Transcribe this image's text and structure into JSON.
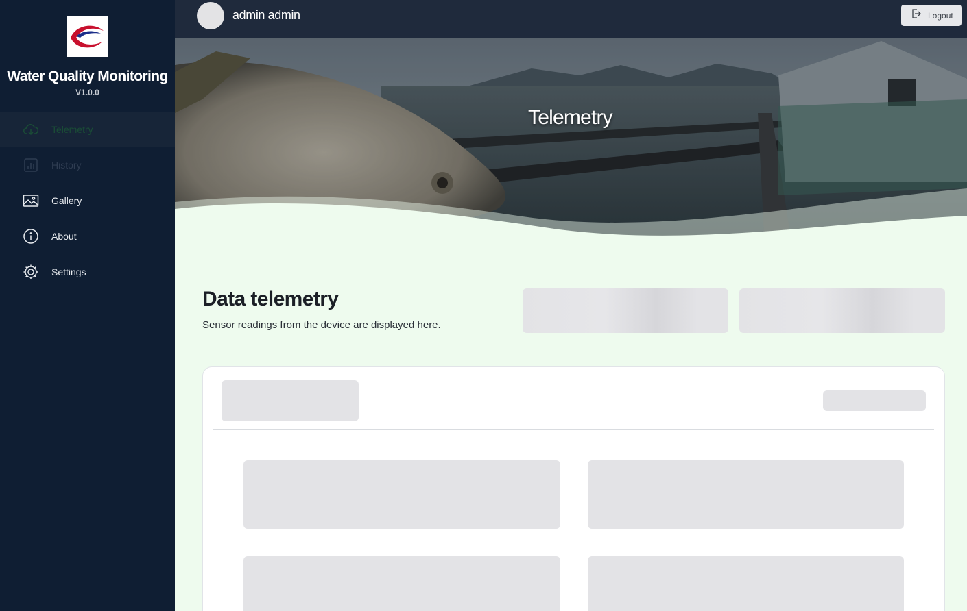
{
  "sidebar": {
    "app_title": "Water Quality Monitoring",
    "version": "V1.0.0",
    "items": [
      {
        "label": "Telemetry",
        "icon": "cloud-download-icon"
      },
      {
        "label": "History",
        "icon": "bar-chart-icon"
      },
      {
        "label": "Gallery",
        "icon": "image-icon"
      },
      {
        "label": "About",
        "icon": "info-icon"
      },
      {
        "label": "Settings",
        "icon": "gear-icon"
      }
    ]
  },
  "header": {
    "username": "admin admin",
    "logout_label": "Logout"
  },
  "hero": {
    "title": "Telemetry"
  },
  "main": {
    "title": "Data telemetry",
    "subtitle": "Sensor readings from the device are displayed here."
  },
  "colors": {
    "sidebar_bg": "#0f1e33",
    "topbar_bg": "#1f2a3c",
    "page_bg": "#eefbee",
    "skeleton": "#e3e3e6"
  }
}
